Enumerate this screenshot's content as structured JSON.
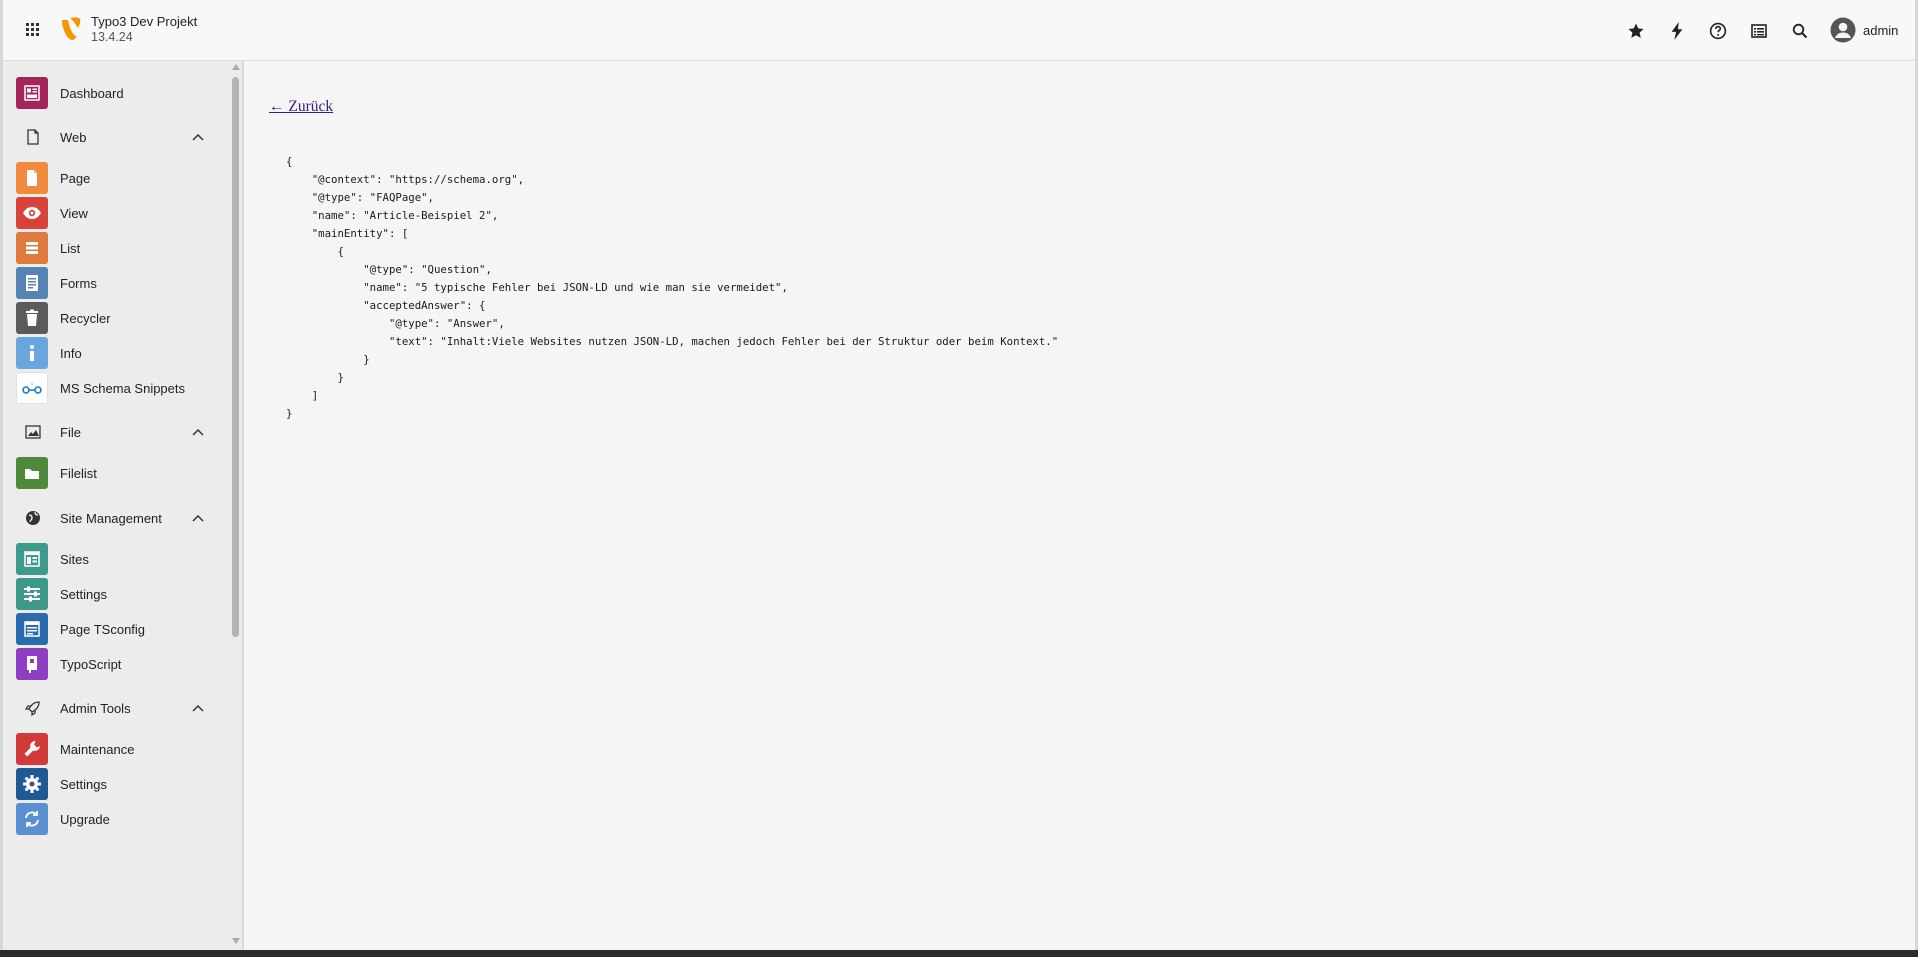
{
  "app": {
    "name": "Typo3 Dev Projekt",
    "version": "13.4.24"
  },
  "user": {
    "name": "admin"
  },
  "topbar_icons": [
    "bookmark-star-icon",
    "flash-icon",
    "help-icon",
    "system-info-icon",
    "search-icon"
  ],
  "sidebar": {
    "dashboard": {
      "label": "Dashboard",
      "color": "#a3245b"
    },
    "web": {
      "label": "Web",
      "items": [
        {
          "label": "Page",
          "color": "#f08a3c"
        },
        {
          "label": "View",
          "color": "#d9413b"
        },
        {
          "label": "List",
          "color": "#e07a3f"
        },
        {
          "label": "Forms",
          "color": "#5583b3"
        },
        {
          "label": "Recycler",
          "color": "#5b5b5b"
        },
        {
          "label": "Info",
          "color": "#6aa6de"
        },
        {
          "label": "MS Schema Snippets",
          "color": "#ffffff"
        }
      ]
    },
    "file": {
      "label": "File",
      "items": [
        {
          "label": "Filelist",
          "color": "#4f8a3a"
        }
      ]
    },
    "site": {
      "label": "Site Management",
      "items": [
        {
          "label": "Sites",
          "color": "#3e9a8e"
        },
        {
          "label": "Settings",
          "color": "#3d9a8a"
        },
        {
          "label": "Page TSconfig",
          "color": "#2a6bb0"
        },
        {
          "label": "TypoScript",
          "color": "#8f3ec4"
        }
      ]
    },
    "admin": {
      "label": "Admin Tools",
      "items": [
        {
          "label": "Maintenance",
          "color": "#d23a3a"
        },
        {
          "label": "Settings",
          "color": "#1f5a94"
        },
        {
          "label": "Upgrade",
          "color": "#5a8fd0"
        }
      ]
    }
  },
  "content": {
    "back_link": "← Zurück",
    "json_ld": "{\n    \"@context\": \"https://schema.org\",\n    \"@type\": \"FAQPage\",\n    \"name\": \"Article-Beispiel 2\",\n    \"mainEntity\": [\n        {\n            \"@type\": \"Question\",\n            \"name\": \"5 typische Fehler bei JSON-LD und wie man sie vermeidet\",\n            \"acceptedAnswer\": {\n                \"@type\": \"Answer\",\n                \"text\": \"Inhalt:Viele Websites nutzen JSON-LD, machen jedoch Fehler bei der Struktur oder beim Kontext.\"\n            }\n        }\n    ]\n}"
  }
}
